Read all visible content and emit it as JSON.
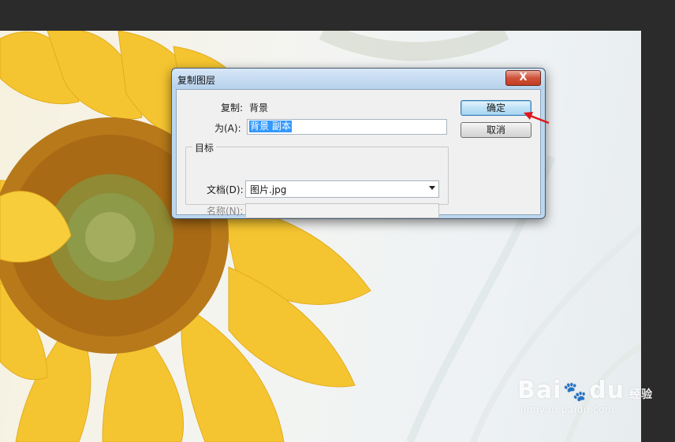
{
  "dialog": {
    "title": "复制图层",
    "close_label": "X",
    "copy_label": "复制:",
    "copy_value": "背景",
    "as_label": "为(A):",
    "as_value": "背景 副本",
    "target_group_label": "目标",
    "document_label": "文档(D):",
    "document_value": "图片.jpg",
    "name_label": "名称(N):",
    "name_value": "",
    "ok_label": "确定",
    "cancel_label": "取消"
  },
  "watermark": {
    "logo_left": "Bai",
    "logo_right": "du",
    "suffix": "经验",
    "url": "jingyan.baidu.com"
  },
  "colors": {
    "annotation_arrow": "#e0161b",
    "selection": "#3399ff"
  },
  "icons": {
    "close": "close-icon",
    "dropdown": "chevron-down-icon",
    "paw": "paw-icon"
  }
}
